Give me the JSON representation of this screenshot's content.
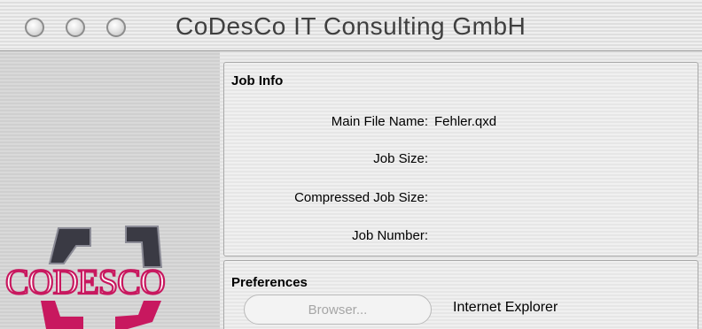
{
  "window": {
    "title": "CoDesCo IT Consulting GmbH"
  },
  "logo": {
    "text": "CODESCO"
  },
  "job_info": {
    "title": "Job Info",
    "rows": [
      {
        "label": "Main File Name:",
        "value": "Fehler.qxd"
      },
      {
        "label": "Job Size:",
        "value": ""
      },
      {
        "label": "Compressed Job Size:",
        "value": ""
      },
      {
        "label": "Job Number:",
        "value": ""
      }
    ]
  },
  "preferences": {
    "title": "Preferences",
    "browser_button": "Browser...",
    "browser_value": "Internet Explorer"
  },
  "colors": {
    "logo_pink": "#c8185f",
    "logo_dark": "#3a3a44",
    "logo_gray": "#8a8a95"
  }
}
